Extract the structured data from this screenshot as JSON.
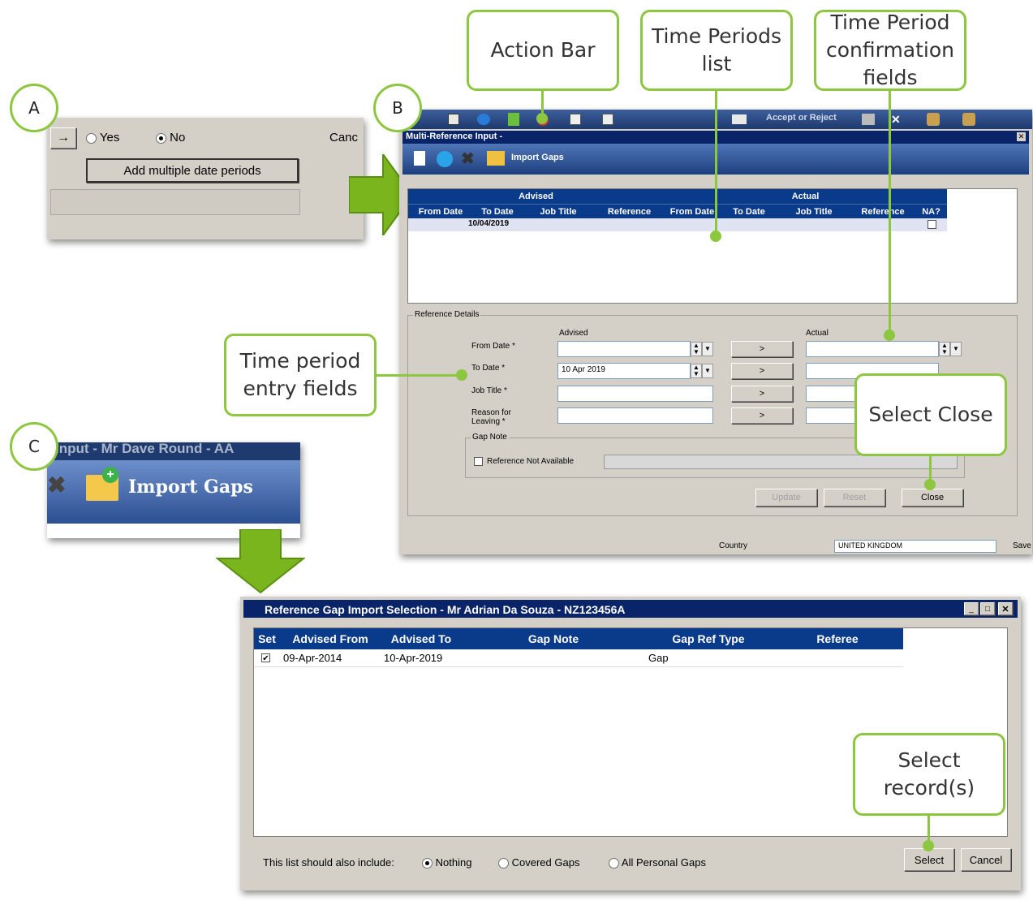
{
  "callouts": {
    "a": "A",
    "b": "B",
    "c": "C",
    "action_bar": "Action Bar",
    "time_periods_list": "Time Periods list",
    "confirmation_fields": "Time Period confirmation fields",
    "entry_fields": "Time period entry fields",
    "select_close": "Select Close",
    "select_records": "Select record(s)"
  },
  "panel_a": {
    "yes_label": "Yes",
    "no_label": "No",
    "cancel_fragment": "Canc",
    "add_periods_button": "Add multiple date periods",
    "arrow_button": "→"
  },
  "panel_b": {
    "toolbar_text": "Accept or Reject",
    "window_title": "Multi-Reference Input -",
    "import_gaps": "Import Gaps",
    "group_advised": "Advised",
    "group_actual": "Actual",
    "columns": [
      "From Date",
      "To Date",
      "Job Title",
      "Reference",
      "From Date",
      "To Date",
      "Job Title",
      "Reference",
      "NA?"
    ],
    "row": {
      "to_date": "10/04/2019"
    },
    "reference_details": "Reference Details",
    "advised_label": "Advised",
    "actual_label": "Actual",
    "from_date_label": "From Date *",
    "to_date_label": "To Date *",
    "job_title_label": "Job Title *",
    "reason_label": "Reason for Leaving *",
    "to_date_value": "10 Apr 2019",
    "copy_arrow": ">",
    "gap_note": "Gap Note",
    "ref_not_available": "Reference Not Available",
    "update": "Update",
    "reset": "Reset",
    "close": "Close",
    "country_label": "Country",
    "country_value": "UNITED KINGDOM",
    "save_fragment": "Save"
  },
  "panel_c": {
    "title_fragment": "Input - Mr Dave Round - AA",
    "import_gaps": "Import Gaps"
  },
  "dialog": {
    "title": "Reference Gap Import Selection - Mr Adrian Da Souza - NZ123456A",
    "columns": [
      "Set",
      "Advised From",
      "Advised To",
      "Gap Note",
      "Gap Ref Type",
      "Referee"
    ],
    "rows": [
      {
        "set": true,
        "advised_from": "09-Apr-2014",
        "advised_to": "10-Apr-2019",
        "gap_note": "",
        "gap_ref_type": "Gap",
        "referee": ""
      }
    ],
    "include_label": "This list should also include:",
    "options": [
      "Nothing",
      "Covered Gaps",
      "All Personal Gaps"
    ],
    "select": "Select",
    "cancel": "Cancel"
  }
}
